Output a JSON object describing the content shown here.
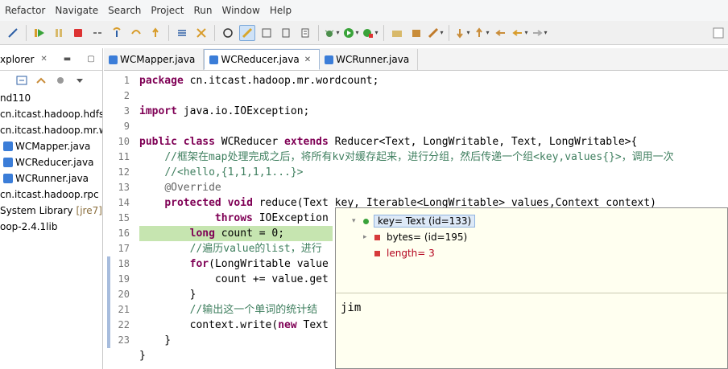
{
  "menu": [
    "Refactor",
    "Navigate",
    "Search",
    "Project",
    "Run",
    "Window",
    "Help"
  ],
  "explorer": {
    "title": "xplorer",
    "items": [
      {
        "label": "nd110",
        "icon": false
      },
      {
        "label": "cn.itcast.hadoop.hdfs",
        "icon": false
      },
      {
        "label": "cn.itcast.hadoop.mr.w",
        "icon": false
      },
      {
        "label": "WCMapper.java",
        "icon": true
      },
      {
        "label": "WCReducer.java",
        "icon": true
      },
      {
        "label": "WCRunner.java",
        "icon": true
      },
      {
        "label": "cn.itcast.hadoop.rpc",
        "icon": false
      },
      {
        "label": "System Library",
        "suffix": "[jre7]",
        "icon": false
      },
      {
        "label": "oop-2.4.1lib",
        "icon": false
      }
    ]
  },
  "tabs": [
    {
      "label": "WCMapper.java",
      "active": false
    },
    {
      "label": "WCReducer.java",
      "active": true
    },
    {
      "label": "WCRunner.java",
      "active": false
    }
  ],
  "code": {
    "lines": [
      {
        "n": "1",
        "text": "package cn.itcast.hadoop.mr.wordcount;"
      },
      {
        "n": "2",
        "text": ""
      },
      {
        "n": "3",
        "text": "import java.io.IOException;"
      },
      {
        "n": "9",
        "text": ""
      },
      {
        "n": "10",
        "text": "public class WCReducer extends Reducer<Text, LongWritable, Text, LongWritable>{"
      },
      {
        "n": "11",
        "text": "    //框架在map处理完成之后，将所有kv对缓存起来，进行分组，然后传递一个组<key,values{}>，调用一次"
      },
      {
        "n": "12",
        "text": "    //<hello,{1,1,1,1...}>"
      },
      {
        "n": "13",
        "text": "    @Override"
      },
      {
        "n": "14",
        "text": "    protected void reduce(Text key, Iterable<LongWritable> values,Context context)"
      },
      {
        "n": "15",
        "text": "            throws IOException"
      },
      {
        "n": "16",
        "text": "        long count = 0;"
      },
      {
        "n": "17",
        "text": "        //遍历value的list，进行"
      },
      {
        "n": "18",
        "text": "        for(LongWritable value"
      },
      {
        "n": "19",
        "text": "            count += value.get"
      },
      {
        "n": "20",
        "text": "        }"
      },
      {
        "n": "21",
        "text": "        //输出这一个单词的统计结"
      },
      {
        "n": "22",
        "text": "        context.write(new Text"
      },
      {
        "n": "23",
        "text": "    }"
      },
      {
        "n": "",
        "text": "}"
      }
    ]
  },
  "popup": {
    "root": "key= Text  (id=133)",
    "children": [
      {
        "label": "bytes= (id=195)",
        "expandable": true
      },
      {
        "label": "length= 3",
        "expandable": false
      }
    ],
    "detail": "jim"
  }
}
